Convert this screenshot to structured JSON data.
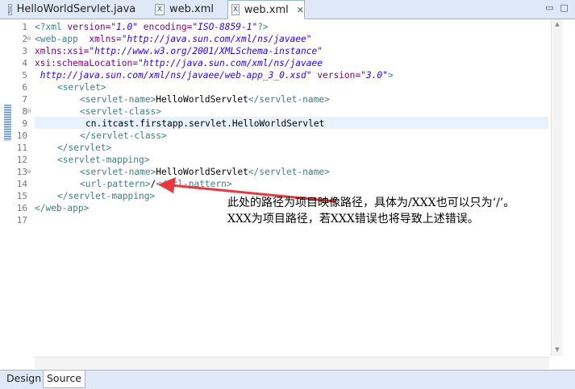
{
  "tabs": [
    {
      "icon": "J",
      "label": "HelloWorldServlet.java",
      "active": false
    },
    {
      "icon": "X",
      "label": "web.xml",
      "active": false
    },
    {
      "icon": "X",
      "label": "web.xml",
      "active": true,
      "close": "✕"
    }
  ],
  "window_controls": {
    "minimize": "▭",
    "maximize": "□"
  },
  "line_numbers": [
    "1",
    "2",
    "3",
    "4",
    "5",
    "6",
    "7",
    "8",
    "9",
    "10",
    "11",
    "12",
    "13",
    "14",
    "15",
    "16",
    "17"
  ],
  "code": {
    "l1": [
      "<?xml ",
      "version=",
      "\"1.0\"",
      " encoding=",
      "\"ISO-8859-1\"",
      "?>"
    ],
    "l2": [
      "<web-app",
      "  xmlns=",
      "\"http://java.sun.com/xml/ns/javaee\""
    ],
    "l3": [
      "xmlns:xsi=",
      "\"http://www.w3.org/2001/XMLSchema-instance\""
    ],
    "l4": [
      "xsi:schemaLocation=",
      "\"http://java.sun.com/xml/ns/javaee"
    ],
    "l5": [
      " http://java.sun.com/xml/ns/javaee/web-app_3_0.xsd\"",
      " version=",
      "\"3.0\"",
      ">"
    ],
    "l6": [
      "<servlet>"
    ],
    "l7": [
      "<servlet-name>",
      "HelloWorldServlet",
      "</servlet-name>"
    ],
    "l8": [
      "<servlet-class>"
    ],
    "l9": [
      "cn.itcast.firstapp.servlet.HelloWorldServlet"
    ],
    "l10": [
      "</servlet-class>"
    ],
    "l11": [
      "</servlet>"
    ],
    "l12": [
      "<servlet-mapping>"
    ],
    "l13": [
      "<servlet-name>",
      "HelloWorldServlet",
      "</servlet-name>"
    ],
    "l14": [
      "<url-pattern>",
      "/",
      "</url-pattern>"
    ],
    "l15": [
      "</servlet-mapping>"
    ],
    "l16": [
      "</web-app>"
    ]
  },
  "annotation": {
    "line1": "此处的路径为项目映像路径，具体为/XXX也可以只为‘/’。",
    "line2": "XXX为项目路径，若XXX错误也将导致上述错误。",
    "arrow_color": "#e8383d"
  },
  "bottom_tabs": [
    {
      "label": "Design",
      "active": false
    },
    {
      "label": "Source",
      "active": true
    }
  ]
}
